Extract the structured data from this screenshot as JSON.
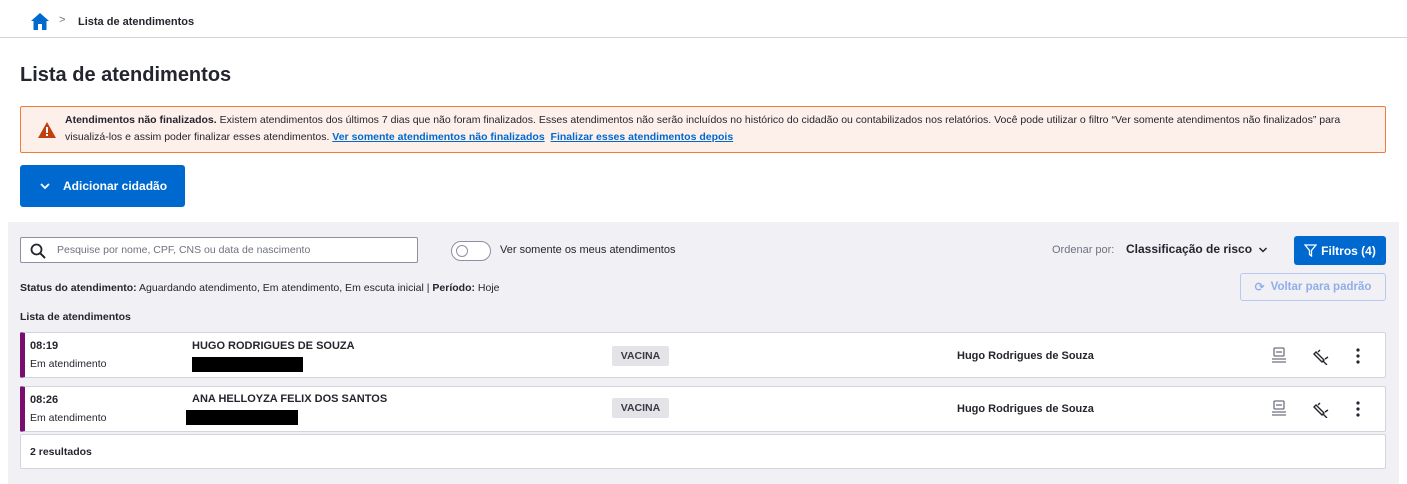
{
  "breadcrumb": {
    "home_icon": "home-icon",
    "separator": ">",
    "current": "Lista de atendimentos"
  },
  "page": {
    "title": "Lista de atendimentos"
  },
  "alert": {
    "icon": "warning-icon",
    "color": "#f07c3a",
    "title": "Atendimentos não finalizados.",
    "message": " Existem atendimentos dos últimos 7 dias que não foram finalizados. Esses atendimentos não serão incluídos no histórico do cidadão ou contabilizados nos relatórios. Você pode utilizar o filtro “Ver somente atendimentos não finalizados” para visualizá-los e assim poder finalizar esses atendimentos. ",
    "link_view_unfinished": "Ver somente atendimentos não finalizados",
    "link_finish_later": "Finalizar esses atendimentos depois"
  },
  "add_citizen": {
    "label": "Adicionar cidadão",
    "icon": "chevron-down-icon"
  },
  "toolbar": {
    "search_placeholder": "Pesquise por nome, CPF, CNS ou data de nascimento",
    "search_value": "",
    "toggle_label": "Ver somente os meus atendimentos",
    "toggle_on": false,
    "sort_label": "Ordenar por:",
    "sort_value": "Classificação de risco",
    "filters_label": "Filtros (4)",
    "reset_label": "Voltar para padrão"
  },
  "status_summary": {
    "status_label": "Status do atendimento:",
    "status_value": " Aguardando atendimento, Em atendimento, Em escuta inicial | ",
    "period_label": "Período:",
    "period_value": " Hoje"
  },
  "list": {
    "title": "Lista de atendimentos",
    "accent_color": "#7a0e6e",
    "rows": [
      {
        "time": "08:19",
        "status": "Em atendimento",
        "name": "HUGO RODRIGUES DE SOUZA",
        "tag": "VACINA",
        "professional": "Hugo Rodrigues de Souza"
      },
      {
        "time": "08:26",
        "status": "Em atendimento",
        "name": "ANA HELLOYZA FELIX DOS SANTOS",
        "tag": "VACINA",
        "professional": "Hugo Rodrigues de Souza"
      }
    ],
    "results": "2 resultados"
  }
}
